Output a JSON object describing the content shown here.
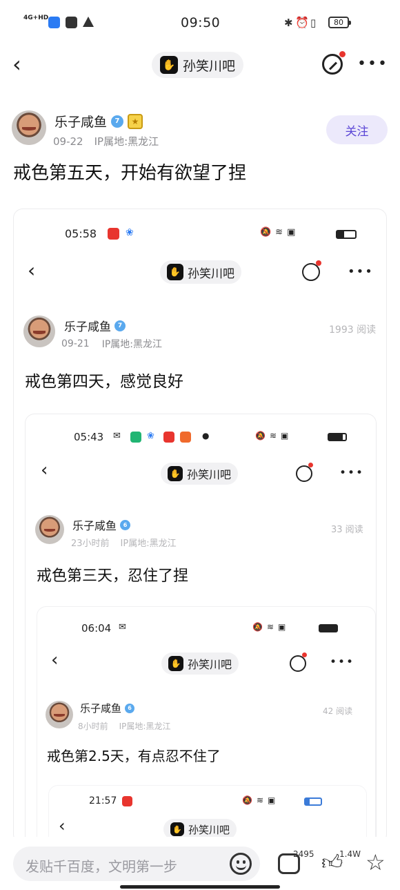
{
  "status": {
    "time": "09:50",
    "network": "4G+HD",
    "battery": "80"
  },
  "nav": {
    "forum_name": "孙笑川吧"
  },
  "post": {
    "author": "乐子咸鱼",
    "level": "7",
    "date": "09-22",
    "ip": "IP属地:黑龙江",
    "follow_label": "关注",
    "title": "戒色第五天，开始有欲望了捏"
  },
  "shot1": {
    "time": "05:58",
    "forum_name": "孙笑川吧",
    "author": "乐子咸鱼",
    "level": "7",
    "date": "09-21",
    "ip": "IP属地:黑龙江",
    "reads": "1993 阅读",
    "title": "戒色第四天，感觉良好"
  },
  "shot2": {
    "time": "05:43",
    "forum_name": "孙笑川吧",
    "author": "乐子咸鱼",
    "level": "6",
    "date": "23小时前",
    "ip": "IP属地:黑龙江",
    "reads": "33 阅读",
    "title": "戒色第三天，忍住了捏"
  },
  "shot3": {
    "time": "06:04",
    "forum_name": "孙笑川吧",
    "author": "乐子咸鱼",
    "level": "6",
    "date": "8小时前",
    "ip": "IP属地:黑龙江",
    "reads": "42 阅读",
    "title": "戒色第2.5天，有点忍不住了"
  },
  "shot4": {
    "time": "21:57",
    "forum_name": "孙笑川吧"
  },
  "bottom": {
    "reply_placeholder": "发贴千百度，文明第一步",
    "comment_count": "2495",
    "like_count": "1.4W"
  },
  "colors": {
    "accent": "#5b46d6",
    "follow_bg": "#ece9fb",
    "notify_dot": "#e8352e"
  }
}
